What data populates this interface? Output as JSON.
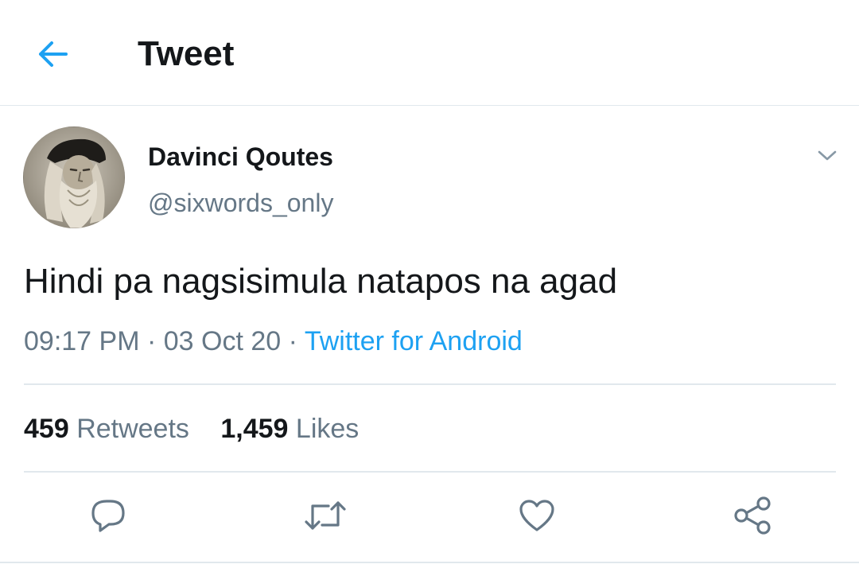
{
  "header": {
    "title": "Tweet",
    "back_icon": "arrow-left-icon"
  },
  "tweet": {
    "author": {
      "display_name": "Davinci Qoutes",
      "handle": "@sixwords_only",
      "avatar": "portrait-avatar"
    },
    "text": "Hindi pa nagsisimula natapos na agad",
    "time": "09:17 PM",
    "separator": "·",
    "date": "03 Oct 20",
    "source": "Twitter for Android",
    "menu_icon": "chevron-down-icon"
  },
  "stats": {
    "retweets_count": "459",
    "retweets_label": "Retweets",
    "likes_count": "1,459",
    "likes_label": "Likes"
  },
  "actions": [
    {
      "icon": "reply-icon"
    },
    {
      "icon": "retweet-icon"
    },
    {
      "icon": "like-icon"
    },
    {
      "icon": "share-icon"
    }
  ],
  "colors": {
    "accent": "#1da1f2",
    "text_primary": "#14171a",
    "text_secondary": "#657786",
    "divider": "#e1e8ed"
  }
}
